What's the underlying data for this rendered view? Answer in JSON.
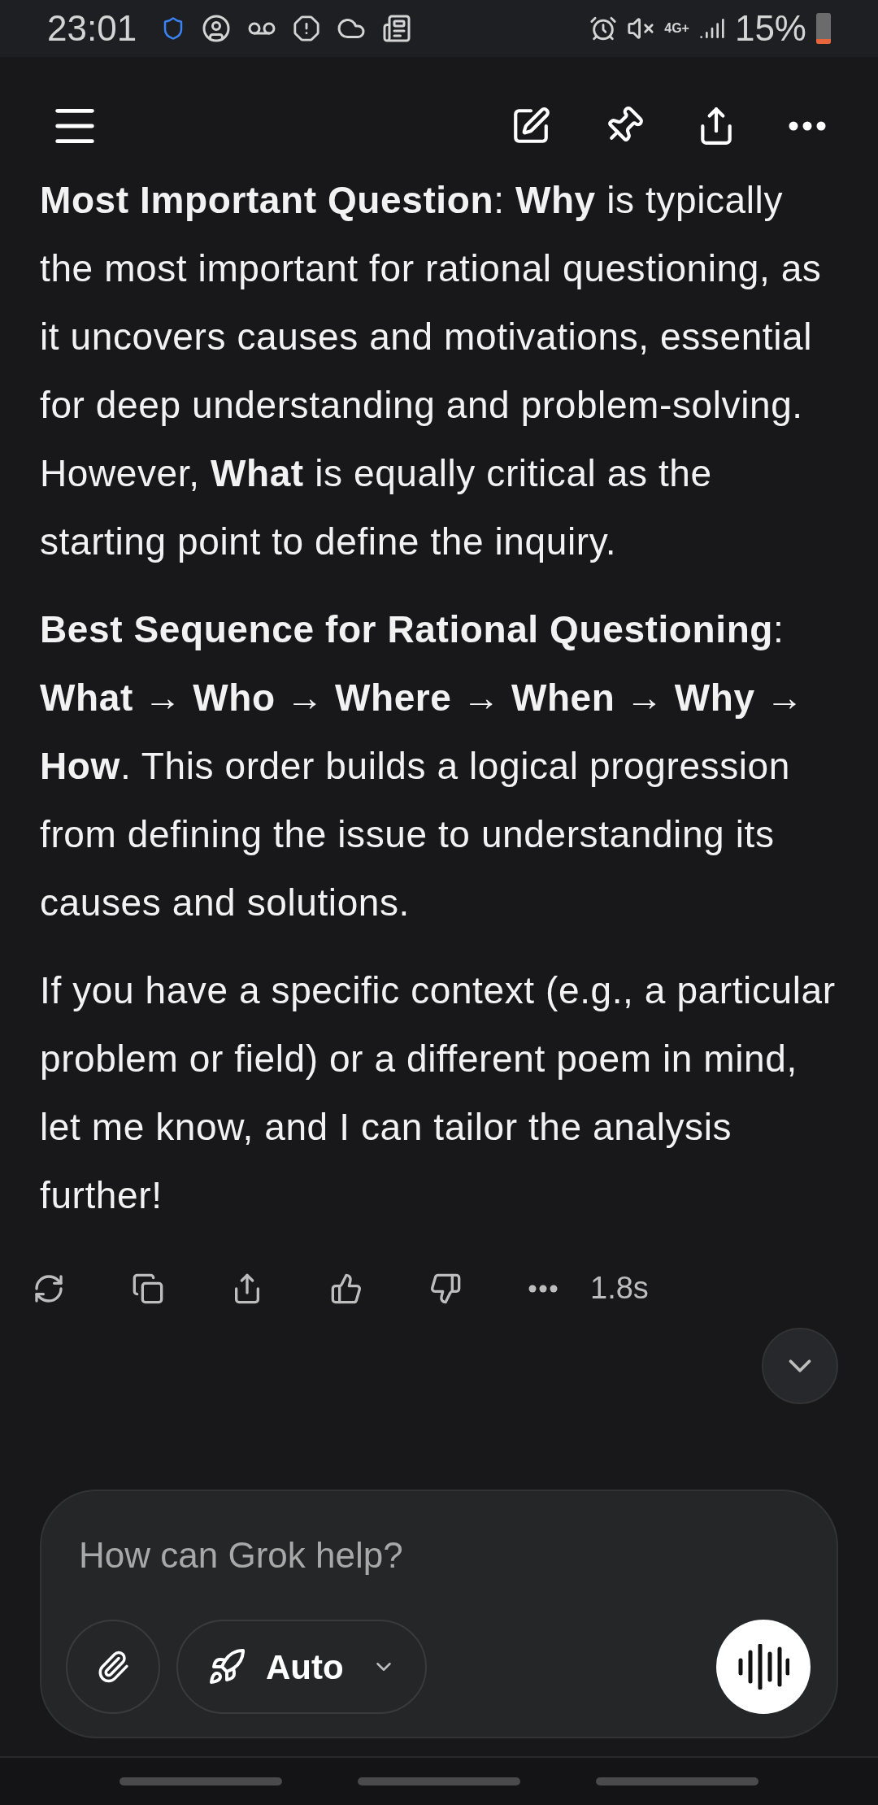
{
  "status_bar": {
    "time": "23:01",
    "network": "4G+",
    "battery": "15%"
  },
  "paragraphs": [
    "**Most Important Question**: **Why** is typically the most important for rational questioning, as it uncovers causes and motivations, essential for deep understanding and problem-solving. However, **What** is equally critical as the starting point to define the inquiry.",
    "**Best Sequence for Rational Questioning**: **What → Who → Where → When → Why → How**. This order builds a logical progression from defining the issue to understanding its causes and solutions.",
    "If you have a specific context (e.g., a particular problem or field) or a different poem in mind, let me know, and I can tailor the analysis further!"
  ],
  "response_time": "1.8s",
  "composer": {
    "placeholder": "How can Grok help?",
    "mode": "Auto"
  }
}
